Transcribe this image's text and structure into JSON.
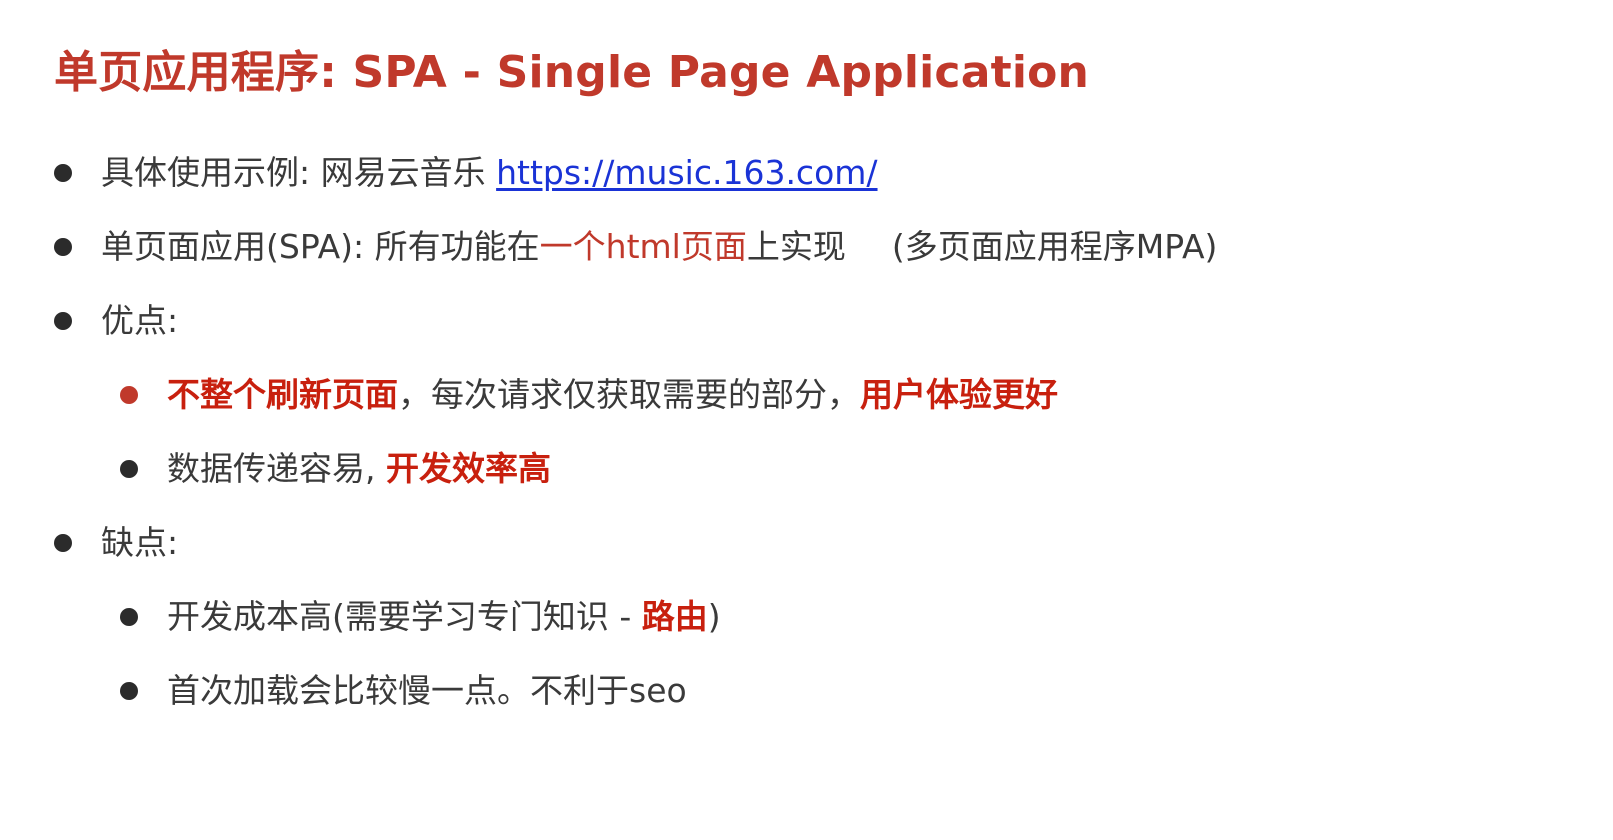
{
  "title": "单页应用程序: SPA - Single Page Application",
  "items": [
    {
      "prefix": "具体使用示例: 网易云音乐 ",
      "link": "https://music.163.com/"
    },
    {
      "prefix": "单页面应用(SPA): 所有功能在",
      "highlight": "一个html页面",
      "suffix": "上实现",
      "aside": "(多页面应用程序MPA)"
    },
    {
      "label": "优点:",
      "children": [
        {
          "bold1": "不整个刷新页面",
          "middle": "，每次请求仅获取需要的部分，",
          "bold2": "用户体验更好"
        },
        {
          "prefix": "数据传递容易, ",
          "bold": "开发效率高"
        }
      ]
    },
    {
      "label": "缺点:",
      "children": [
        {
          "prefix": "开发成本高(需要学习专门知识 - ",
          "bold": "路由",
          "suffix": ")"
        },
        {
          "text": "首次加载会比较慢一点。不利于seo"
        }
      ]
    }
  ],
  "colors": {
    "accent": "#c0392b",
    "emphasis": "#c8200e",
    "link": "#1a33d6",
    "text": "#3a3a3a",
    "bullet": "#2b2b2b"
  }
}
